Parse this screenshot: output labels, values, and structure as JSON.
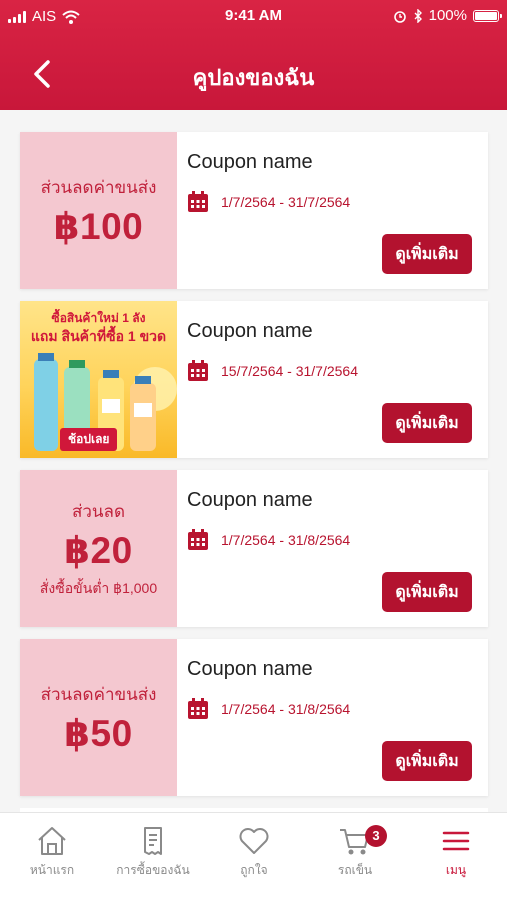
{
  "status_bar": {
    "carrier": "AIS",
    "time": "9:41 AM",
    "battery": "100%",
    "battery_level": 1.0
  },
  "header": {
    "title": "คูปองของฉัน",
    "back_icon": "chevron-left-icon"
  },
  "coupons": [
    {
      "type": "text",
      "label": "ส่วนลดค่าขนส่ง",
      "amount": "฿100",
      "min": "",
      "name": "Coupon name",
      "date": "1/7/2564 - 31/7/2564",
      "button": "ดูเพิ่มเติม"
    },
    {
      "type": "image",
      "promo_line1": "ซื้อสินค้าใหม่ 1 ลัง",
      "promo_line2": "แถม สินค้าที่ซื้อ 1 ขวด",
      "promo_shop": "ช้อปเลย",
      "name": "Coupon name",
      "date": "15/7/2564 - 31/7/2564",
      "button": "ดูเพิ่มเติม"
    },
    {
      "type": "text",
      "label": "ส่วนลด",
      "amount": "฿20",
      "min": "สั่งซื้อขั้นต่ำ ฿1,000",
      "name": "Coupon name",
      "date": "1/7/2564 - 31/8/2564",
      "button": "ดูเพิ่มเติม"
    },
    {
      "type": "text",
      "label": "ส่วนลดค่าขนส่ง",
      "amount": "฿50",
      "min": "",
      "name": "Coupon name",
      "date": "1/7/2564 - 31/8/2564",
      "button": "ดูเพิ่มเติม"
    }
  ],
  "tabbar": {
    "items": [
      {
        "label": "หน้าแรก",
        "icon": "home-icon"
      },
      {
        "label": "การซื้อของฉัน",
        "icon": "receipt-icon"
      },
      {
        "label": "ถูกใจ",
        "icon": "heart-icon"
      },
      {
        "label": "รถเข็น",
        "icon": "cart-icon",
        "badge": "3"
      },
      {
        "label": "เมนู",
        "icon": "menu-icon",
        "active": true
      }
    ]
  },
  "colors": {
    "primary": "#c8173a",
    "button": "#b3122f",
    "coupon_bg": "#f4c8d0",
    "inactive": "#8a8a8a"
  }
}
